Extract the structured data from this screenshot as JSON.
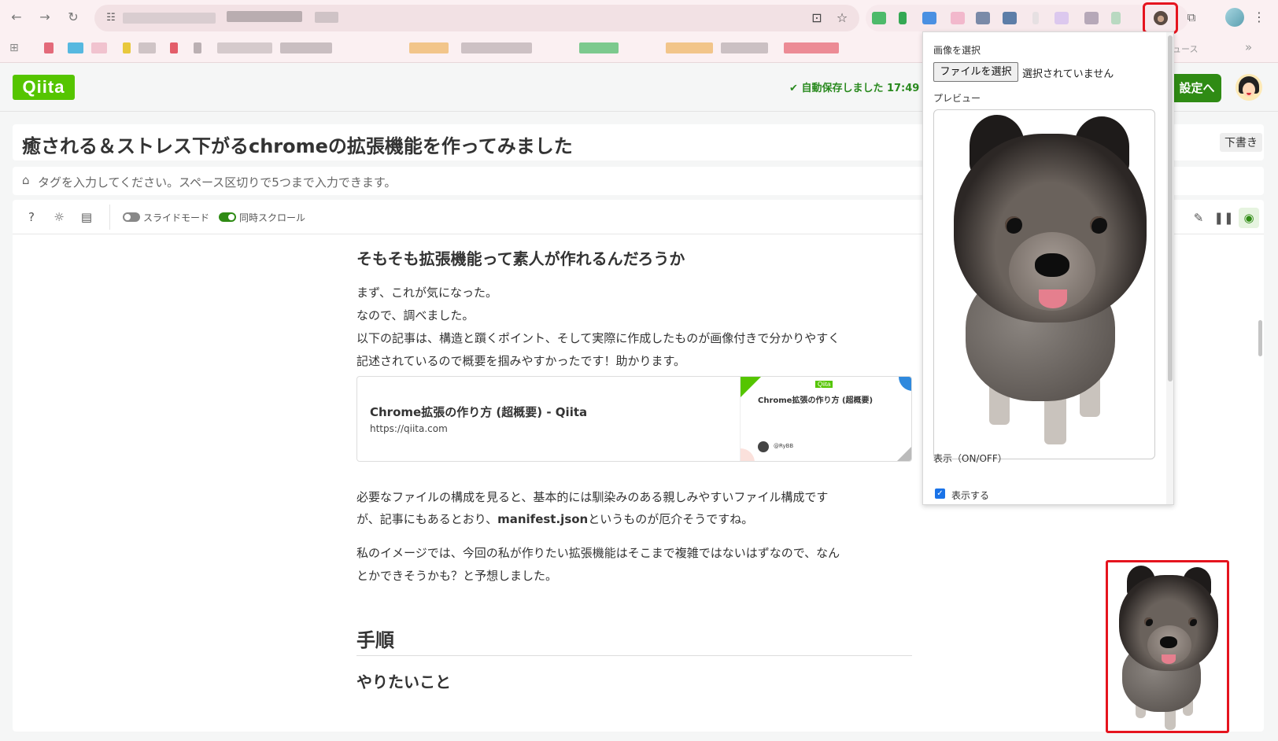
{
  "browser": {
    "bookmark_news_label": "ュース"
  },
  "header": {
    "logo": "Qiita",
    "autosave_text": "自動保存しました 17:49",
    "publish_label": "設定へ"
  },
  "editor": {
    "title": "癒される＆ストレス下がるchromeの拡張機能を作ってみました",
    "draft_badge": "下書き",
    "tags_placeholder": "タグを入力してください。スペース区切りで5つまで入力できます。",
    "toolbar": {
      "slide_mode_label": "スライドモード",
      "sync_scroll_label": "同時スクロール"
    }
  },
  "article": {
    "section_heading": "そもそも拡張機能って素人が作れるんだろうか",
    "para1_lines": [
      "まず、これが気になった。",
      "なので、調べました。",
      "以下の記事は、構造と躓くポイント、そして実際に作成したものが画像付きで分かりやすく",
      "記述されているので概要を掴みやすかったです！助かります。"
    ],
    "link_card": {
      "title": "Chrome拡張の作り方 (超概要) - Qiita",
      "url": "https://qiita.com",
      "thumb_badge": "Qiita",
      "thumb_title": "Chrome拡張の作り方 (超概要)",
      "thumb_user": "@RyBB"
    },
    "para2_line1": "必要なファイルの構成を見ると、基本的には馴染みのある親しみやすいファイル構成です",
    "para2_line2_pre": "が、記事にもあるとおり、",
    "para2_line2_bold": "manifest.json",
    "para2_line2_post": "というものが厄介そうですね。",
    "para3_lines": [
      "私のイメージでは、今回の私が作りたい拡張機能はそこまで複雑ではないはずなので、なん",
      "とかできそうかも？と予想しました。"
    ],
    "h1": "手順",
    "h2_next": "やりたいこと"
  },
  "popup": {
    "select_image_label": "画像を選択",
    "file_button": "ファイルを選択",
    "file_status": "選択されていません",
    "preview_label": "プレビュー",
    "display_label": "表示（ON/OFF）",
    "checkbox_label": "表示する",
    "checkbox_checked": true
  },
  "colors": {
    "qiita_green": "#55c500",
    "publish_green": "#2f8b14",
    "highlight_red": "#e5141e"
  }
}
